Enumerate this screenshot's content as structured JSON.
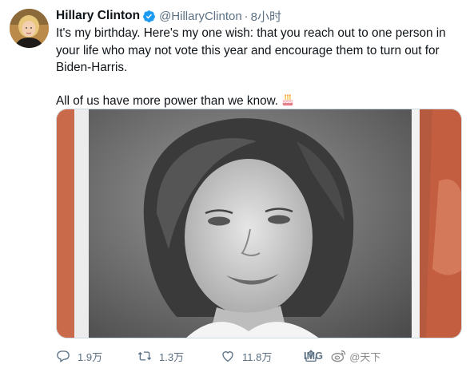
{
  "tweet": {
    "author_name": "Hillary Clinton",
    "handle": "@HillaryClinton",
    "separator": "·",
    "time": "8小时",
    "paragraph1": "It's my birthday. Here's my one wish: that you reach out to one person in your life who may not vote this year and encourage them to turn out for Biden-Harris.",
    "paragraph2": "All of us have more power than we know.",
    "emoji_icon": "birthday-cake-icon",
    "verified_color": "#1d9bf0"
  },
  "actions": {
    "reply_count": "1.9万",
    "retweet_count": "1.3万",
    "like_count": "11.8万"
  },
  "watermark": {
    "img_label": "IMG",
    "text": "@天下"
  },
  "colors": {
    "text": "#0f1419",
    "secondary": "#5b7083",
    "accent": "#1d9bf0"
  }
}
